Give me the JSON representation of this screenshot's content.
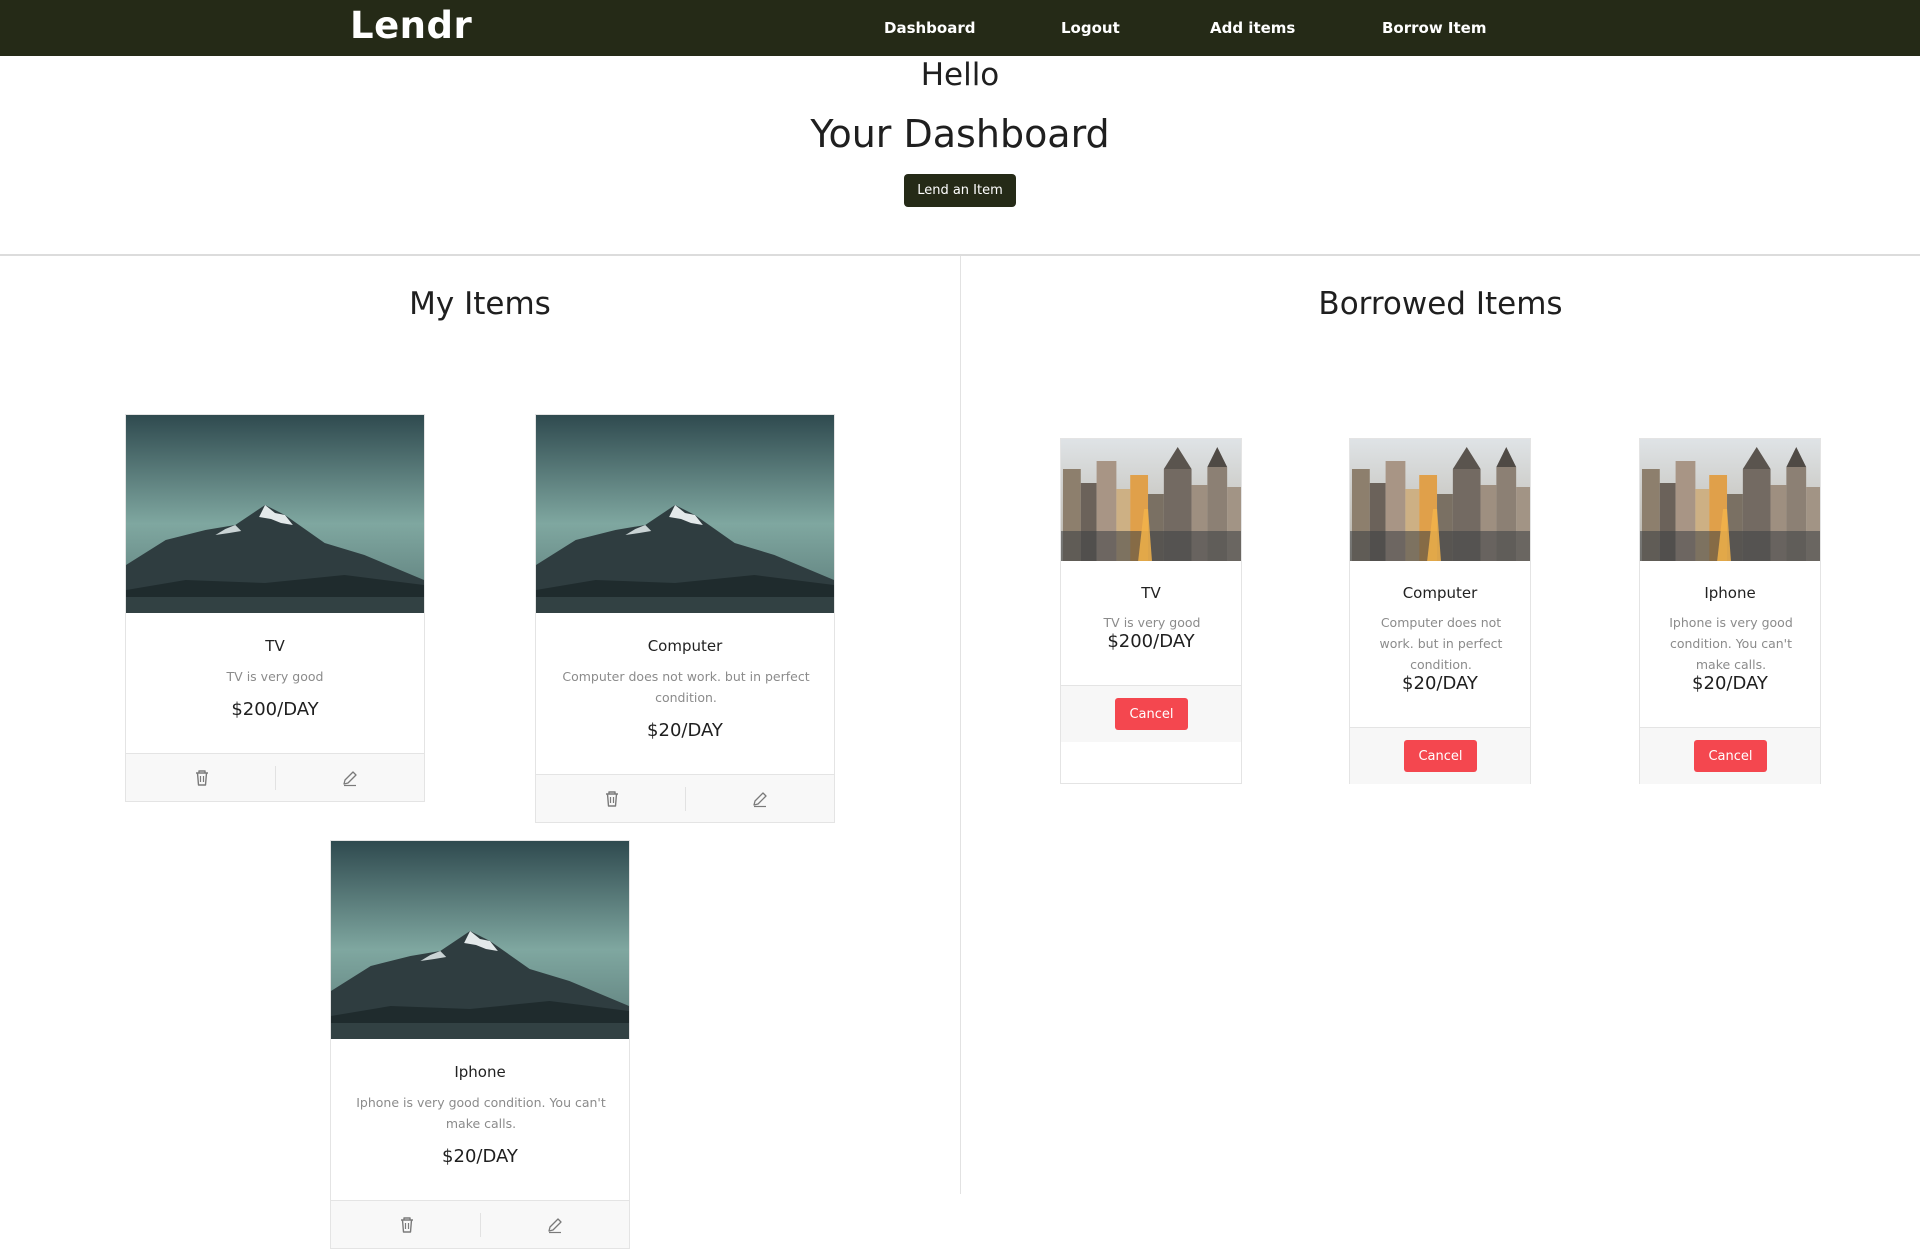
{
  "navbar": {
    "brand": "Lendr",
    "links": [
      "Dashboard",
      "Logout",
      "Add items",
      "Borrow Item"
    ]
  },
  "header": {
    "greeting": "Hello",
    "title": "Your Dashboard",
    "lend_button": "Lend an Item"
  },
  "my_items": {
    "title": "My Items",
    "items": [
      {
        "name": "TV",
        "description": "TV is very good",
        "price": "$200/DAY",
        "image": "mountain-photo"
      },
      {
        "name": "Computer",
        "description": "Computer does not work. but in perfect condition.",
        "price": "$20/DAY",
        "image": "mountain-photo"
      },
      {
        "name": "Iphone",
        "description": "Iphone is very good condition. You can't make calls.",
        "price": "$20/DAY",
        "image": "mountain-photo"
      }
    ],
    "footer_icons": [
      "trash-icon",
      "pencil-icon"
    ]
  },
  "borrowed_items": {
    "title": "Borrowed Items",
    "items": [
      {
        "name": "TV",
        "description": "TV is very good",
        "price": "$200/DAY",
        "button": "Cancel",
        "image": "city-photo"
      },
      {
        "name": "Computer",
        "description": "Computer does not work. but in perfect condition.",
        "price": "$20/DAY",
        "button": "Cancel",
        "image": "city-photo"
      },
      {
        "name": "Iphone",
        "description": "Iphone is very good condition. You can't make calls.",
        "price": "$20/DAY",
        "button": "Cancel",
        "image": "city-photo"
      }
    ]
  },
  "colors": {
    "navbar_bg": "#252a17",
    "cancel_red": "#f4474f",
    "text_muted": "#8b8b8b"
  }
}
